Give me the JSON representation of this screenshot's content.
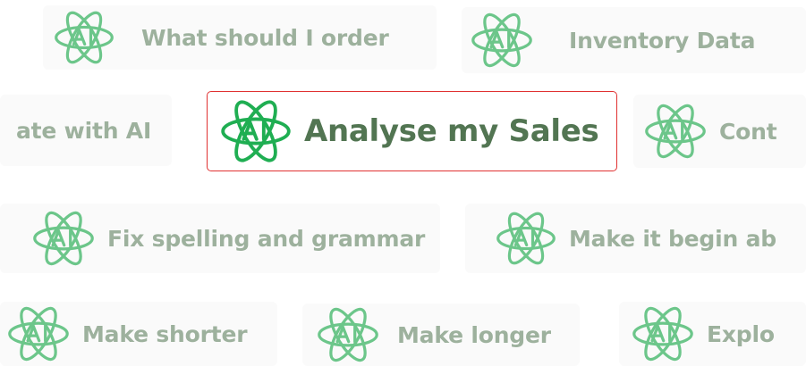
{
  "accent_color": "#6cc68a",
  "featured_icon_color": "#1fae52",
  "featured_border_color": "#e03131",
  "chips": [
    {
      "id": "order",
      "label": "What should I order",
      "icon": "ai-atom-icon"
    },
    {
      "id": "inventory",
      "label": "Inventory Data",
      "icon": "ai-atom-icon"
    },
    {
      "id": "create",
      "label": "ate with AI",
      "icon": "ai-atom-icon"
    },
    {
      "id": "analyse",
      "label": "Analyse my Sales",
      "icon": "ai-atom-icon",
      "selected": true
    },
    {
      "id": "continue",
      "label": "Cont",
      "icon": "ai-atom-icon"
    },
    {
      "id": "spelling",
      "label": "Fix spelling and grammar",
      "icon": "ai-atom-icon"
    },
    {
      "id": "begin",
      "label": "Make it begin ab",
      "icon": "ai-atom-icon"
    },
    {
      "id": "shorter",
      "label": "Make shorter",
      "icon": "ai-atom-icon"
    },
    {
      "id": "longer",
      "label": "Make longer",
      "icon": "ai-atom-icon"
    },
    {
      "id": "explore",
      "label": "Explo",
      "icon": "ai-atom-icon"
    }
  ]
}
